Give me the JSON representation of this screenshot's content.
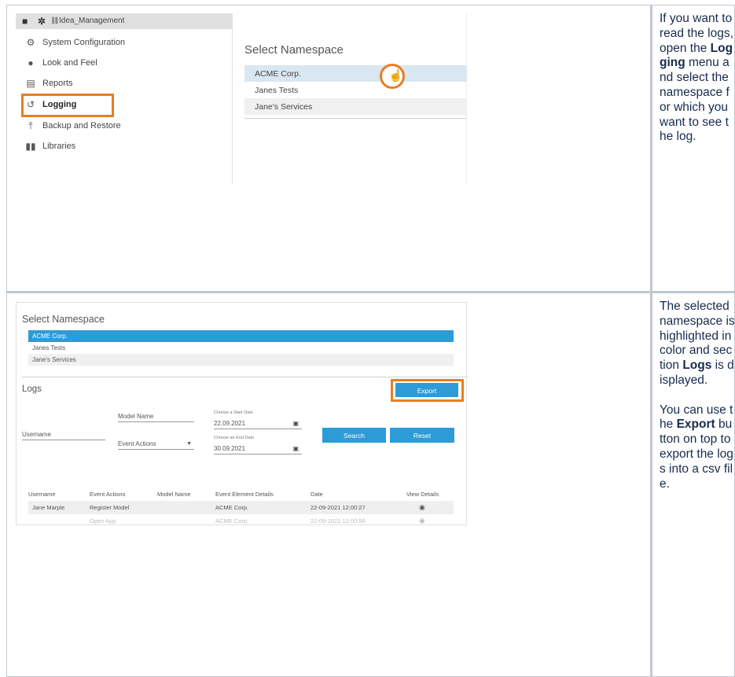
{
  "colors": {
    "accent_orange": "#e67e22",
    "primary_blue": "#2d9bd6",
    "hover_row": "#d9e7f2"
  },
  "shot1": {
    "project_name": "Idea_Management",
    "nav": [
      {
        "label": "System Configuration",
        "icon": "gears-icon"
      },
      {
        "label": "Look and Feel",
        "icon": "palette-icon"
      },
      {
        "label": "Reports",
        "icon": "document-icon"
      },
      {
        "label": "Logging",
        "icon": "history-icon"
      },
      {
        "label": "Backup and Restore",
        "icon": "upload-icon"
      },
      {
        "label": "Libraries",
        "icon": "books-icon"
      }
    ],
    "select_namespace_title": "Select Namespace",
    "namespaces": [
      "ACME Corp.",
      "Janes Tests",
      "Jane's Services"
    ]
  },
  "text1": {
    "p1_a": "If you want to read the logs, open the ",
    "p1_b": "Logging",
    "p1_c": " menu and select the namespace for which you want to see the log."
  },
  "shot2": {
    "title": "Select Namespace",
    "namespaces": [
      "ACME Corp.",
      "Janes Tests",
      "Jane's Services"
    ],
    "logs_title": "Logs",
    "export_label": "Export",
    "model_name_label": "Model Name",
    "username_label": "Username",
    "event_actions_label": "Event Actions",
    "start_date_label": "Choose a Start Date",
    "start_date": "22.09.2021",
    "end_date_label": "Choose an End Date",
    "end_date": "30.09.2021",
    "search_label": "Search",
    "reset_label": "Reset",
    "columns": [
      "Username",
      "Event Actions",
      "Model Name",
      "Event Element Details",
      "Date",
      "View Details"
    ],
    "rows": [
      {
        "username": "Jane Marple",
        "action": "Register Model",
        "model": "",
        "details": "ACME Corp.",
        "date": "22-09-2021 12:00:27"
      },
      {
        "username": "",
        "action": "Open App",
        "model": "",
        "details": "ACME Corp.",
        "date": "22-09-2021 12:00:56"
      }
    ]
  },
  "text2": {
    "p1_a": "The selected namespace is highlighted in color and section ",
    "p1_b": "Logs",
    "p1_c": " is displayed.",
    "p2_a": "You can use the ",
    "p2_b": "Export",
    "p2_c": " button on top to export the logs into a csv file."
  }
}
